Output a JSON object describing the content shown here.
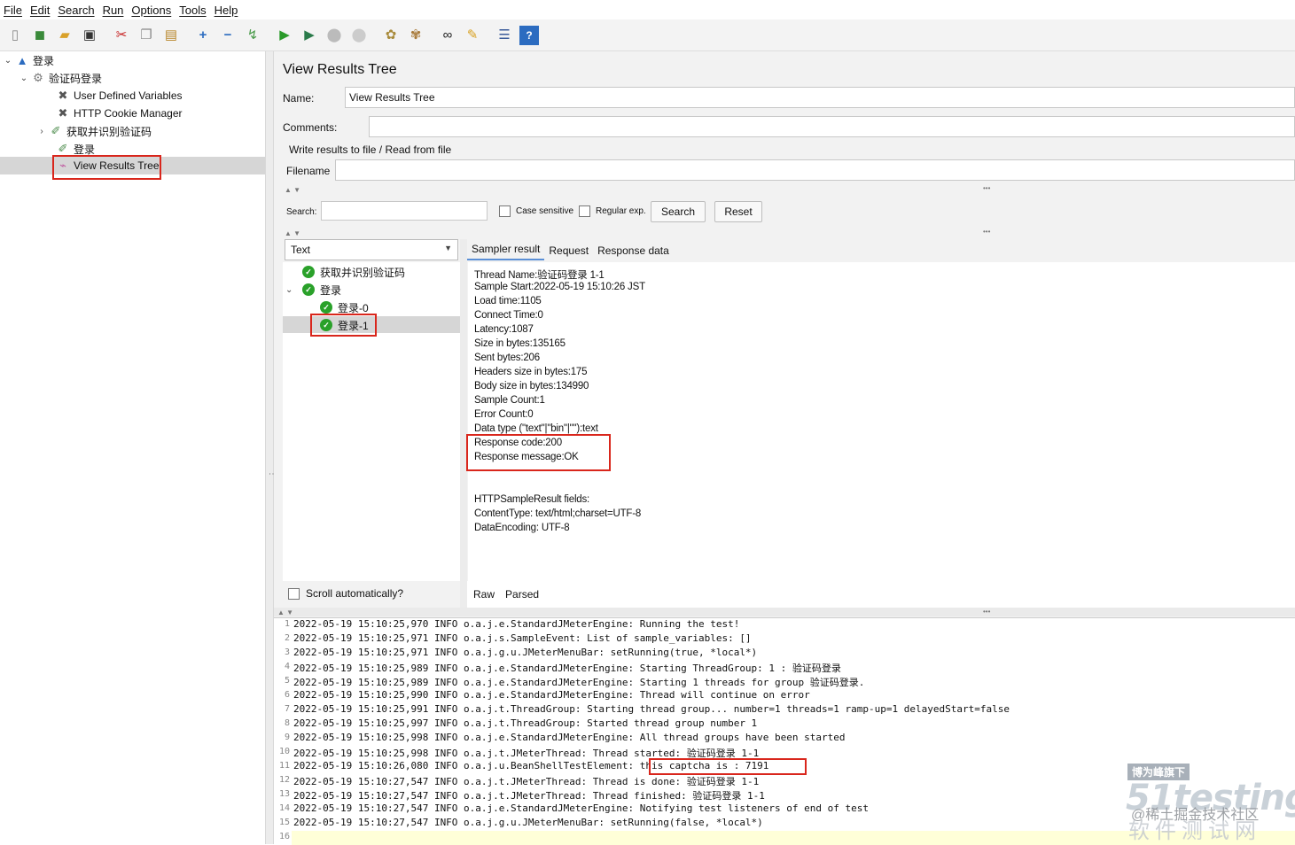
{
  "menu": {
    "items": [
      "File",
      "Edit",
      "Search",
      "Run",
      "Options",
      "Tools",
      "Help"
    ]
  },
  "toolbar": {
    "icons": [
      "new-icon",
      "templates-icon",
      "open-icon",
      "save-icon",
      "cut-icon",
      "copy-icon",
      "paste-icon",
      "expand-icon",
      "collapse-icon",
      "toggle-icon",
      "start-icon",
      "start-no-pause-icon",
      "stop-icon",
      "shutdown-icon",
      "clear-icon",
      "clear-all-icon",
      "search-icon",
      "reset-search-icon",
      "function-helper-icon",
      "help-icon"
    ]
  },
  "tree": {
    "root": "登录",
    "thread_group": "验证码登录",
    "children": [
      "User Defined Variables",
      "HTTP Cookie Manager",
      "获取并识别验证码",
      "登录",
      "View Results Tree"
    ]
  },
  "panel": {
    "title": "View Results Tree",
    "name_label": "Name:",
    "name_value": "View Results Tree",
    "comments_label": "Comments:",
    "write_results_label": "Write results to file / Read from file",
    "filename_label": "Filename",
    "search_label": "Search:",
    "case_sensitive": "Case sensitive",
    "regular_exp": "Regular exp.",
    "search_button": "Search",
    "reset_button": "Reset",
    "renderer": "Text",
    "scroll_auto": "Scroll automatically?"
  },
  "results_tree": {
    "items": [
      "获取并识别验证码",
      "登录",
      "登录-0",
      "登录-1"
    ]
  },
  "tabs": {
    "sampler_result": "Sampler result",
    "request": "Request",
    "response_data": "Response data",
    "raw": "Raw",
    "parsed": "Parsed"
  },
  "sampler_result": {
    "lines": [
      "Thread Name:验证码登录 1-1",
      "Sample Start:2022-05-19 15:10:26 JST",
      "Load time:1105",
      "Connect Time:0",
      "Latency:1087",
      "Size in bytes:135165",
      "Sent bytes:206",
      "Headers size in bytes:175",
      "Body size in bytes:134990",
      "Sample Count:1",
      "Error Count:0",
      "Data type (\"text\"|\"bin\"|\"\"):text",
      "Response code:200",
      "Response message:OK",
      "",
      "",
      "HTTPSampleResult fields:",
      "ContentType: text/html;charset=UTF-8",
      "DataEncoding: UTF-8"
    ]
  },
  "log": {
    "numbers": [
      "1",
      "2",
      "3",
      "4",
      "5",
      "6",
      "7",
      "8",
      "9",
      "10",
      "11",
      "12",
      "13",
      "14",
      "15",
      "16"
    ],
    "lines": [
      "2022-05-19 15:10:25,970 INFO o.a.j.e.StandardJMeterEngine: Running the test!",
      "2022-05-19 15:10:25,971 INFO o.a.j.s.SampleEvent: List of sample_variables: []",
      "2022-05-19 15:10:25,971 INFO o.a.j.g.u.JMeterMenuBar: setRunning(true, *local*)",
      "2022-05-19 15:10:25,989 INFO o.a.j.e.StandardJMeterEngine: Starting ThreadGroup: 1 : 验证码登录",
      "2022-05-19 15:10:25,989 INFO o.a.j.e.StandardJMeterEngine: Starting 1 threads for group 验证码登录.",
      "2022-05-19 15:10:25,990 INFO o.a.j.e.StandardJMeterEngine: Thread will continue on error",
      "2022-05-19 15:10:25,991 INFO o.a.j.t.ThreadGroup: Starting thread group... number=1 threads=1 ramp-up=1 delayedStart=false",
      "2022-05-19 15:10:25,997 INFO o.a.j.t.ThreadGroup: Started thread group number 1",
      "2022-05-19 15:10:25,998 INFO o.a.j.e.StandardJMeterEngine: All thread groups have been started",
      "2022-05-19 15:10:25,998 INFO o.a.j.t.JMeterThread: Thread started: 验证码登录 1-1",
      "2022-05-19 15:10:26,080 INFO o.a.j.u.BeanShellTestElement: this captcha is : 7191",
      "2022-05-19 15:10:27,547 INFO o.a.j.t.JMeterThread: Thread is done: 验证码登录 1-1",
      "2022-05-19 15:10:27,547 INFO o.a.j.t.JMeterThread: Thread finished: 验证码登录 1-1",
      "2022-05-19 15:10:27,547 INFO o.a.j.e.StandardJMeterEngine: Notifying test listeners of end of test",
      "2022-05-19 15:10:27,547 INFO o.a.j.g.u.JMeterMenuBar: setRunning(false, *local*)",
      ""
    ]
  },
  "watermark": {
    "badge": "博为峰旗下",
    "logo": "51testing",
    "cn": "软件测试网",
    "community": "@稀土掘金技术社区"
  },
  "colors": {
    "highlight_box": "#d9261c",
    "ok_icon": "#2aa12a",
    "selection": "#d6d6d6",
    "tab_underline": "#5a8fd6"
  }
}
